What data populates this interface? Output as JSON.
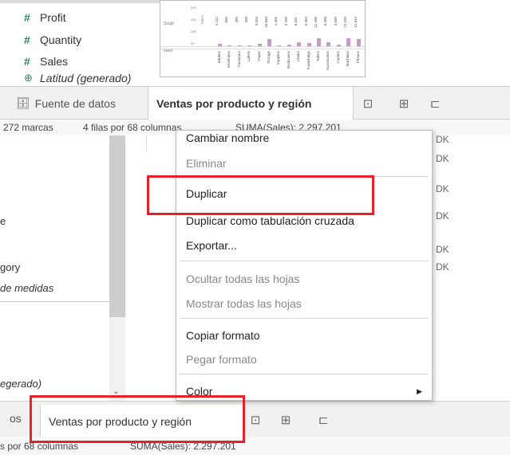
{
  "fields": [
    {
      "icon": "#",
      "label": "Profit"
    },
    {
      "icon": "#",
      "label": "Quantity"
    },
    {
      "icon": "#",
      "label": "Sales"
    },
    {
      "icon": "globe",
      "label": "Latitud (generado)"
    }
  ],
  "preview": {
    "row_labels": [
      "South",
      "West"
    ],
    "axis_label": "Sales",
    "ticks": [
      "60K",
      "40K",
      "20K",
      "0K"
    ],
    "category_labels": [
      "Binders",
      "Envelopes",
      "Fasteners",
      "Labels",
      "Paper",
      "Storage",
      "Supplies",
      "Bookcases",
      "Chairs",
      "Furnishings",
      "Tables",
      "Accessories",
      "Copiers",
      "Machines",
      "Phones"
    ],
    "value_labels": [
      "4.112",
      "896",
      "285",
      "288",
      "3.923",
      "10.840",
      "1.456",
      "2.709",
      "6.331",
      "5.383",
      "12.498",
      "6.380",
      "2.560",
      "12.239",
      "11.644"
    ],
    "bar_values": [
      4112,
      896,
      285,
      288,
      3923,
      10840,
      1456,
      2709,
      6331,
      5383,
      12498,
      6380,
      2560,
      12239,
      11644
    ],
    "bar_color": "#c79bc7"
  },
  "tabs": {
    "datasource": "Fuente de datos",
    "sheet": "Ventas por producto y región",
    "datasource_fragment": "os"
  },
  "status": {
    "marks": "272 marcas",
    "rows_cols": "4 filas por 68 columnas",
    "sum": "SUMA(Sales): 2.297.201",
    "rows_cols_fragment": "s por 68 columnas"
  },
  "left_fragments": {
    "e": "e",
    "gory": "gory",
    "measures": "de medidas",
    "generado": "egerado)"
  },
  "k_fragments": [
    "DK",
    "DK",
    "DK",
    "DK",
    "DK",
    "DK"
  ],
  "context_menu": {
    "items": [
      {
        "label": "Cambiar nombre",
        "disabled": false
      },
      {
        "label": "Eliminar",
        "disabled": true
      },
      {
        "label": "Duplicar",
        "disabled": false
      },
      {
        "label": "Duplicar como tabulación cruzada",
        "disabled": false
      },
      {
        "label": "Exportar...",
        "disabled": false
      },
      {
        "label": "Ocultar todas las hojas",
        "disabled": true
      },
      {
        "label": "Mostrar todas las hojas",
        "disabled": true
      },
      {
        "label": "Copiar formato",
        "disabled": false
      },
      {
        "label": "Pegar formato",
        "disabled": true
      },
      {
        "label": "Color",
        "disabled": false
      }
    ]
  },
  "colors": {
    "highlight": "#e8202a",
    "field_icon": "#2e8b57"
  }
}
